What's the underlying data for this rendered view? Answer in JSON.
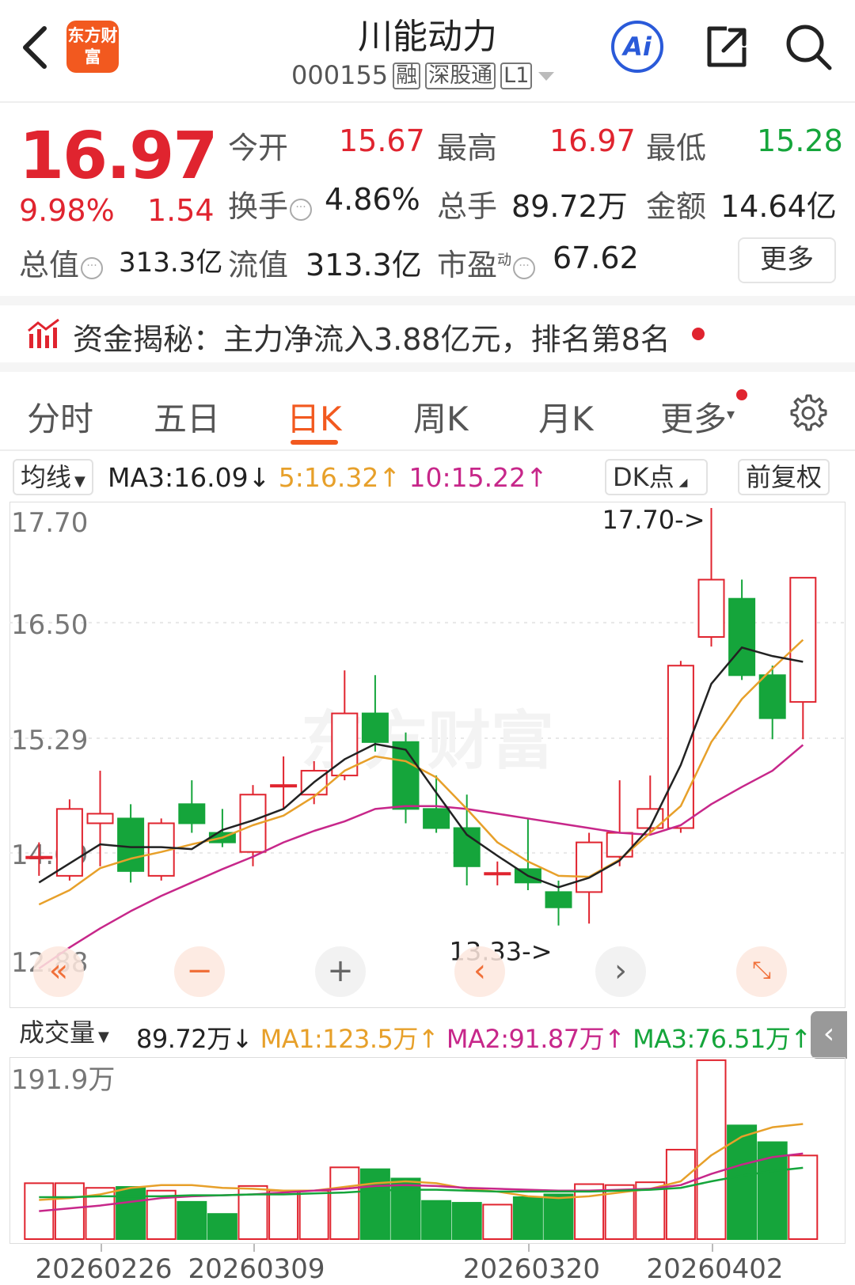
{
  "header": {
    "logo_text": "东方财富",
    "stock_name": "川能动力",
    "stock_code": "000155",
    "tags": [
      "融",
      "深股通",
      "L1"
    ],
    "ai_label": "Ai"
  },
  "quote": {
    "price": "16.97",
    "change_pct": "9.98%",
    "change": "1.54",
    "open_label": "今开",
    "open": "15.67",
    "high_label": "最高",
    "high": "16.97",
    "low_label": "最低",
    "low": "15.28",
    "turnover_label": "换手",
    "turnover": "4.86%",
    "volume_label": "总手",
    "volume": "89.72万",
    "amount_label": "金额",
    "amount": "14.64亿",
    "mcap_label": "总值",
    "mcap": "313.3亿",
    "float_label": "流值",
    "float_mcap": "313.3亿",
    "pe_label": "市盈",
    "pe_sup": "动",
    "pe": "67.62",
    "more_label": "更多"
  },
  "fund_flow": {
    "text": "资金揭秘：主力净流入3.88亿元，排名第8名"
  },
  "tabs": [
    "分时",
    "五日",
    "日K",
    "周K",
    "月K",
    "更多"
  ],
  "active_tab": "日K",
  "ma_bar": {
    "selector": "均线",
    "ma3": "MA3:16.09↓",
    "ma5": "5:16.32↑",
    "ma10": "10:15.22↑",
    "dk_label": "DK点",
    "adjust_label": "前复权"
  },
  "volume_bar": {
    "selector": "成交量",
    "current": "89.72万↓",
    "ma1": "MA1:123.5万↑",
    "ma2": "MA2:91.87万↑",
    "ma3": "MA3:76.51万↑"
  },
  "colors": {
    "up": "#e0242f",
    "down": "#15a53b",
    "accent": "#f2591f",
    "ma_fast": "#222222",
    "ma_mid": "#e7a02a",
    "ma_slow": "#c7278a"
  },
  "chart_data": {
    "type": "candlestick",
    "price_axis_labels": [
      "17.70",
      "16.50",
      "15.29",
      "14.09",
      "12.88"
    ],
    "ylim": [
      12.88,
      17.7
    ],
    "max_marker": "17.70->",
    "min_marker": "13.33->",
    "volume_axis_label": "191.9万",
    "volume_ylim": [
      0,
      191.9
    ],
    "date_labels": [
      "20260226",
      "20260309",
      "20260320",
      "20260402"
    ],
    "date_label_indices": [
      2,
      7,
      16,
      22
    ],
    "candles": [
      {
        "o": 14.05,
        "c": 14.05,
        "h": 14.2,
        "l": 13.85
      },
      {
        "o": 13.85,
        "c": 14.55,
        "h": 14.65,
        "l": 13.8
      },
      {
        "o": 14.4,
        "c": 14.5,
        "h": 14.95,
        "l": 13.95
      },
      {
        "o": 14.45,
        "c": 13.9,
        "h": 14.6,
        "l": 13.78
      },
      {
        "o": 13.85,
        "c": 14.4,
        "h": 14.45,
        "l": 13.8
      },
      {
        "o": 14.6,
        "c": 14.4,
        "h": 14.85,
        "l": 14.3
      },
      {
        "o": 14.3,
        "c": 14.2,
        "h": 14.55,
        "l": 14.15
      },
      {
        "o": 14.1,
        "c": 14.7,
        "h": 14.8,
        "l": 13.95
      },
      {
        "o": 14.8,
        "c": 14.8,
        "h": 15.1,
        "l": 14.55
      },
      {
        "o": 14.7,
        "c": 14.95,
        "h": 15.05,
        "l": 14.6
      },
      {
        "o": 14.9,
        "c": 15.55,
        "h": 16.0,
        "l": 14.85
      },
      {
        "o": 15.55,
        "c": 15.25,
        "h": 15.95,
        "l": 15.15
      },
      {
        "o": 15.25,
        "c": 14.55,
        "h": 15.35,
        "l": 14.4
      },
      {
        "o": 14.55,
        "c": 14.35,
        "h": 14.9,
        "l": 14.3
      },
      {
        "o": 14.35,
        "c": 13.95,
        "h": 14.7,
        "l": 13.75
      },
      {
        "o": 13.88,
        "c": 13.88,
        "h": 14.0,
        "l": 13.75
      },
      {
        "o": 13.92,
        "c": 13.78,
        "h": 14.45,
        "l": 13.7
      },
      {
        "o": 13.68,
        "c": 13.52,
        "h": 13.8,
        "l": 13.33
      },
      {
        "o": 13.68,
        "c": 14.2,
        "h": 14.3,
        "l": 13.35
      },
      {
        "o": 14.05,
        "c": 14.3,
        "h": 14.85,
        "l": 13.95
      },
      {
        "o": 14.35,
        "c": 14.55,
        "h": 14.9,
        "l": 14.3
      },
      {
        "o": 14.35,
        "c": 16.05,
        "h": 16.1,
        "l": 14.3
      },
      {
        "o": 16.35,
        "c": 16.95,
        "h": 17.7,
        "l": 16.25
      },
      {
        "o": 16.75,
        "c": 15.95,
        "h": 16.95,
        "l": 15.9
      },
      {
        "o": 15.95,
        "c": 15.5,
        "h": 16.05,
        "l": 15.28
      },
      {
        "o": 15.67,
        "c": 16.97,
        "h": 16.97,
        "l": 15.28
      }
    ],
    "ma3": [
      13.78,
      13.98,
      14.18,
      14.15,
      14.15,
      14.13,
      14.33,
      14.43,
      14.55,
      14.83,
      15.07,
      15.23,
      15.17,
      14.72,
      14.28,
      14.06,
      13.85,
      13.73,
      13.83,
      14.01,
      14.36,
      15.01,
      15.86,
      16.24,
      16.15,
      16.09
    ],
    "ma5": [
      13.55,
      13.7,
      13.93,
      14.03,
      14.1,
      14.18,
      14.25,
      14.38,
      14.48,
      14.68,
      14.95,
      15.1,
      15.05,
      14.88,
      14.55,
      14.2,
      14.0,
      13.85,
      13.84,
      14.02,
      14.3,
      14.58,
      15.25,
      15.7,
      16.02,
      16.32
    ],
    "ma10": [
      12.88,
      13.1,
      13.3,
      13.48,
      13.64,
      13.78,
      13.92,
      14.05,
      14.2,
      14.32,
      14.42,
      14.55,
      14.58,
      14.58,
      14.55,
      14.5,
      14.45,
      14.4,
      14.35,
      14.3,
      14.28,
      14.38,
      14.6,
      14.78,
      14.95,
      15.22
    ],
    "volume": [
      60,
      60,
      55,
      56,
      52,
      40,
      27,
      57,
      52,
      52,
      77,
      75,
      65,
      41,
      39,
      37,
      45,
      48,
      59,
      58,
      61,
      96,
      192,
      122,
      104,
      89.72
    ],
    "volume_ma1": [
      42,
      44,
      48,
      55,
      58,
      58,
      55,
      54,
      52,
      52,
      56,
      60,
      62,
      60,
      54,
      51,
      46,
      44,
      46,
      50,
      54,
      62,
      90,
      110,
      120,
      123.5
    ],
    "volume_ma2": [
      30,
      33,
      36,
      40,
      44,
      46,
      47,
      48,
      50,
      52,
      54,
      57,
      58,
      57,
      55,
      54,
      53,
      52,
      52,
      53,
      54,
      58,
      70,
      80,
      88,
      91.87
    ],
    "volume_ma3": [
      45,
      45,
      46,
      46,
      46,
      47,
      47,
      48,
      48,
      49,
      50,
      52,
      53,
      53,
      52,
      51,
      51,
      51,
      51,
      52,
      53,
      55,
      62,
      68,
      73,
      76.51
    ]
  }
}
